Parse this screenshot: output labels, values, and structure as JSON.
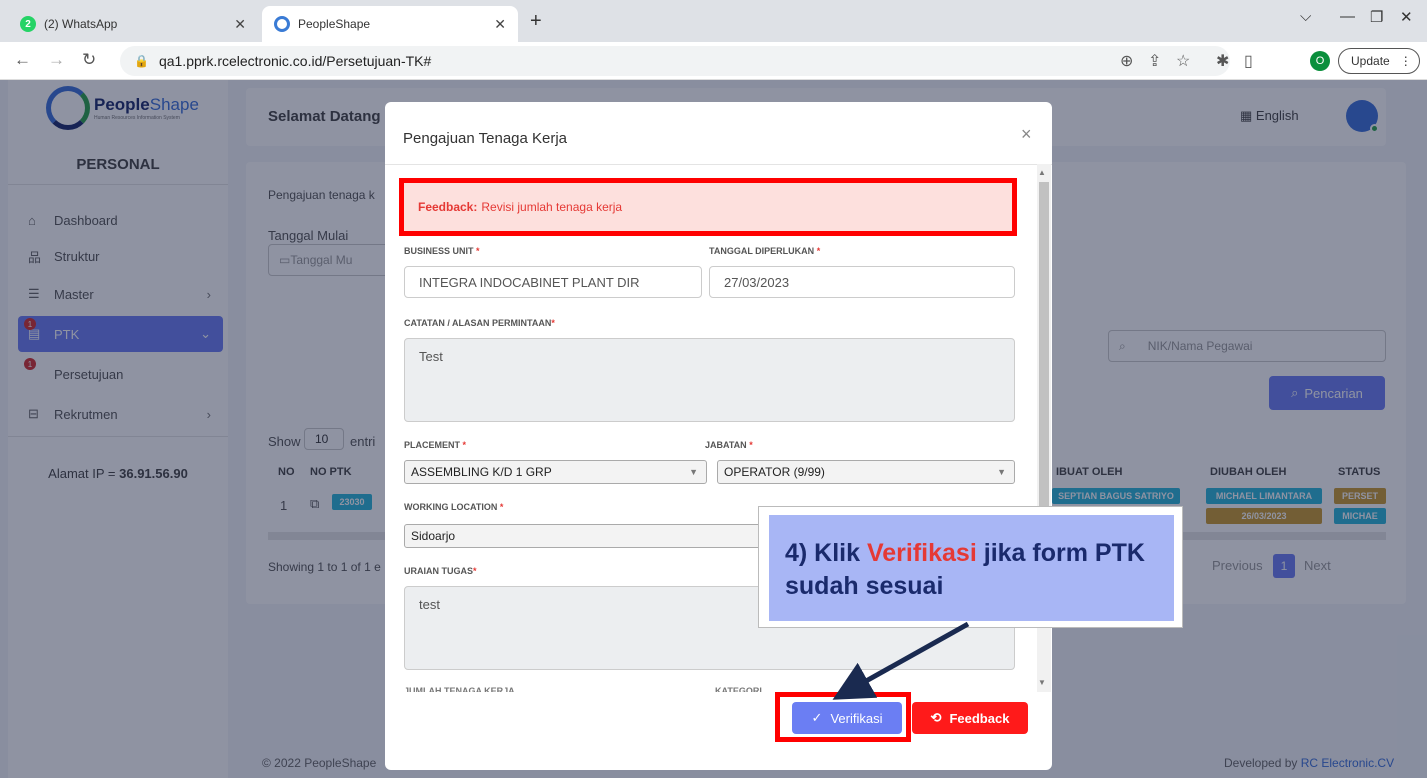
{
  "browser": {
    "tabs": [
      {
        "label": "(2) WhatsApp",
        "badge": "2"
      },
      {
        "label": "PeopleShape"
      }
    ],
    "url": "qa1.pprk.rcelectronic.co.id/Persetujuan-TK#",
    "profile_initial": "O",
    "update_label": "Update"
  },
  "app": {
    "logo_name_bold": "People",
    "logo_name_light": "Shape",
    "logo_tagline": "Human Resources Information System",
    "section": "PERSONAL",
    "sidebar": [
      {
        "label": "Dashboard",
        "icon": "home-icon"
      },
      {
        "label": "Struktur",
        "icon": "org-icon"
      },
      {
        "label": "Master",
        "icon": "database-icon"
      },
      {
        "label": "PTK",
        "icon": "document-icon",
        "badge": "1",
        "active": true
      },
      {
        "label": "Persetujuan",
        "icon": "check-icon",
        "badge": "1"
      },
      {
        "label": "Rekrutmen",
        "icon": "briefcase-icon"
      }
    ],
    "ip_label": "Alamat IP",
    "ip_value": "36.91.56.90",
    "welcome": "Selamat Datang",
    "language": "English",
    "card": {
      "intro": "Pengajuan tenaga k",
      "tanggal_mulai": "Tanggal Mulai",
      "tanggal_placeholder": "Tanggal Mu",
      "search_placeholder": "NIK/Nama Pegawai",
      "search_button": "Pencarian",
      "show_label": "Show",
      "show_value": "10",
      "entries_label": "entri",
      "columns": [
        "NO",
        "NO PTK",
        "IBUAT OLEH",
        "DIUBAH OLEH",
        "STATUS"
      ],
      "row": {
        "no": "1",
        "ptk": "23030",
        "dibuat": "SEPTIAN BAGUS SATRIYO",
        "diubah": "MICHAEL LIMANTARA",
        "diubah_date": "26/03/2023",
        "status1": "PERSET",
        "status2": "MICHAE"
      },
      "showing": "Showing 1 to 1 of 1 e",
      "prev": "Previous",
      "page": "1",
      "next": "Next"
    },
    "footer_left": "© 2022 PeopleShape",
    "footer_right_prefix": "Developed by ",
    "footer_right_link": "RC Electronic.CV"
  },
  "modal": {
    "title": "Pengajuan Tenaga Kerja",
    "feedback_label": "Feedback:",
    "feedback_text": "Revisi jumlah tenaga kerja",
    "business_unit_label": "BUSINESS UNIT",
    "business_unit_value": "INTEGRA INDOCABINET PLANT DIR",
    "tanggal_label": "TANGGAL DIPERLUKAN",
    "tanggal_value": "27/03/2023",
    "catatan_label": "CATATAN / ALASAN PERMINTAAN",
    "catatan_value": "Test",
    "placement_label": "PLACEMENT",
    "placement_value": "ASSEMBLING K/D 1 GRP",
    "jabatan_label": "JABATAN",
    "jabatan_value": "OPERATOR (9/99)",
    "working_label": "WORKING LOCATION",
    "working_value": "Sidoarjo",
    "uraian_label": "URAIAN TUGAS",
    "uraian_value": "test",
    "jumlah_label_cut": "JUMLAH TENAGA KERJA",
    "kategori_label_cut": "KATEGORI",
    "verif_button": "Verifikasi",
    "feedback_button": "Feedback"
  },
  "callout": {
    "prefix": "4) Klik ",
    "highlight": "Verifikasi",
    "suffix": " jika form PTK sudah sesuai"
  },
  "colors": {
    "accent": "#6b7ef3",
    "danger": "#ff1a1a",
    "annotation": "#ff0000",
    "callout_bg": "#a8b6f5"
  }
}
